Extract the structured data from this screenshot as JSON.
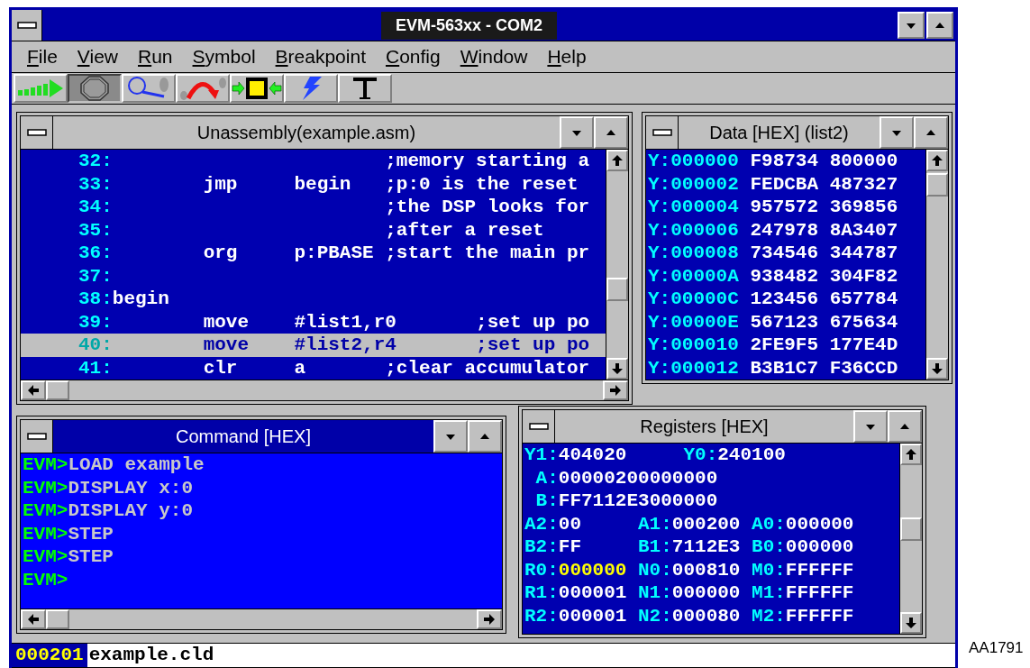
{
  "window": {
    "title": "EVM-563xx - COM2"
  },
  "menu": [
    "File",
    "View",
    "Run",
    "Symbol",
    "Breakpoint",
    "Config",
    "Window",
    "Help"
  ],
  "toolbar": [
    {
      "kind": "go",
      "disabled": false
    },
    {
      "kind": "stop",
      "disabled": true
    },
    {
      "kind": "step",
      "disabled": false
    },
    {
      "kind": "step_over",
      "disabled": false
    },
    {
      "kind": "chip",
      "disabled": false
    },
    {
      "kind": "lightning",
      "disabled": false
    },
    {
      "kind": "text",
      "disabled": false
    }
  ],
  "unassembly": {
    "title": "Unassembly(example.asm)",
    "active": false,
    "rows": [
      {
        "line": "32:",
        "code": "                        ;memory starting a",
        "selected": false
      },
      {
        "line": "33:",
        "code": "        jmp     begin   ;p:0 is the reset",
        "selected": false
      },
      {
        "line": "34:",
        "code": "                        ;the DSP looks for",
        "selected": false
      },
      {
        "line": "35:",
        "code": "                        ;after a reset",
        "selected": false
      },
      {
        "line": "36:",
        "code": "        org     p:PBASE ;start the main pr",
        "selected": false
      },
      {
        "line": "37:",
        "selected": false
      },
      {
        "line": "38:",
        "code": "begin",
        "selected": false
      },
      {
        "line": "39:",
        "code": "        move    #list1,r0       ;set up po",
        "selected": false
      },
      {
        "line": "40:",
        "code": "        move    #list2,r4       ;set up po",
        "selected": true
      },
      {
        "line": "41:",
        "code": "        clr     a       ;clear accumulator",
        "selected": false
      }
    ]
  },
  "data": {
    "title": "Data [HEX] (list2)",
    "active": false,
    "rows": [
      {
        "address": "Y:000000",
        "values": [
          "F98734",
          "800000"
        ]
      },
      {
        "address": "Y:000002",
        "values": [
          "FEDCBA",
          "487327"
        ]
      },
      {
        "address": "Y:000004",
        "values": [
          "957572",
          "369856"
        ]
      },
      {
        "address": "Y:000006",
        "values": [
          "247978",
          "8A3407"
        ]
      },
      {
        "address": "Y:000008",
        "values": [
          "734546",
          "344787"
        ]
      },
      {
        "address": "Y:00000A",
        "values": [
          "938482",
          "304F82"
        ]
      },
      {
        "address": "Y:00000C",
        "values": [
          "123456",
          "657784"
        ]
      },
      {
        "address": "Y:00000E",
        "values": [
          "567123",
          "675634"
        ]
      },
      {
        "address": "Y:000010",
        "values": [
          "2FE9F5",
          "177E4D"
        ]
      },
      {
        "address": "Y:000012",
        "values": [
          "B3B1C7",
          "F36CCD"
        ]
      }
    ]
  },
  "command": {
    "title": "Command [HEX]",
    "active": true,
    "lines": [
      {
        "prompt": "EVM>",
        "text": "LOAD example"
      },
      {
        "prompt": "EVM>",
        "text": "DISPLAY x:0"
      },
      {
        "prompt": "EVM>",
        "text": "DISPLAY y:0"
      },
      {
        "prompt": "EVM>",
        "text": "STEP"
      },
      {
        "prompt": "EVM>",
        "text": "STEP"
      },
      {
        "prompt": "EVM>"
      }
    ]
  },
  "registers": {
    "title": "Registers [HEX]",
    "active": false,
    "rows": [
      [
        {
          "name": "Y1:",
          "value": "404020",
          "changed": false
        },
        {
          "name": "Y0:",
          "value": "240100",
          "changed": false
        }
      ],
      [
        {
          "name": "A:",
          "value": "00000200000000",
          "changed": false
        }
      ],
      [
        {
          "name": "B:",
          "value": "FF7112E3000000",
          "changed": false
        }
      ],
      [
        {
          "name": "A2:",
          "value": "00",
          "changed": false
        },
        {
          "name": "A1:",
          "value": "000200",
          "changed": false
        },
        {
          "name": "A0:",
          "value": "000000",
          "changed": false
        }
      ],
      [
        {
          "name": "B2:",
          "value": "FF",
          "changed": false
        },
        {
          "name": "B1:",
          "value": "7112E3",
          "changed": false
        },
        {
          "name": "B0:",
          "value": "000000",
          "changed": false
        }
      ],
      [
        {
          "name": "R0:",
          "value": "000000",
          "changed": true
        },
        {
          "name": "N0:",
          "value": "000810",
          "changed": false
        },
        {
          "name": "M0:",
          "value": "FFFFFF",
          "changed": false
        }
      ],
      [
        {
          "name": "R1:",
          "value": "000001",
          "changed": false
        },
        {
          "name": "N1:",
          "value": "000000",
          "changed": false
        },
        {
          "name": "M1:",
          "value": "FFFFFF",
          "changed": false
        }
      ],
      [
        {
          "name": "R2:",
          "value": "000001",
          "changed": false
        },
        {
          "name": "N2:",
          "value": "000080",
          "changed": false
        },
        {
          "name": "M2:",
          "value": "FFFFFF",
          "changed": false
        }
      ]
    ]
  },
  "status_bar": {
    "address": "000201",
    "file": "example.cld"
  },
  "figure_label": "AA1791"
}
